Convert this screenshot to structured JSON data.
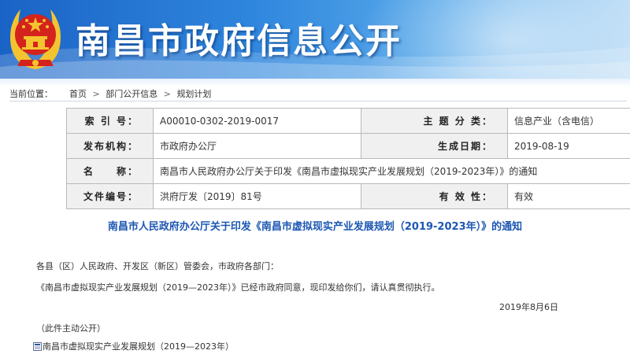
{
  "header": {
    "site_title": "南昌市政府信息公开",
    "colors": {
      "banner_dark": "#1a63c6",
      "banner_light": "#bcdcf6",
      "emblem_red": "#d4231c",
      "emblem_gold": "#f4c430"
    }
  },
  "breadcrumb": {
    "prefix": "当前位置：",
    "items": [
      "首页",
      "部门公开信息",
      "规划计划"
    ],
    "separator": ">"
  },
  "info": {
    "index_label": "索 引 号：",
    "index_value": "A00010-0302-2019-0017",
    "topic_label": "主 题 分 类：",
    "topic_value": "信息产业（含电信）",
    "org_label": "发布机构：",
    "org_value": "市政府办公厅",
    "date_label": "生成日期：",
    "date_value": "2019-08-19",
    "name_label": "名　　称：",
    "name_value": "南昌市人民政府办公厅关于印发《南昌市虚拟现实产业发展规划（2019-2023年）》的通知",
    "docno_label": "文件编号：",
    "docno_value": "洪府厅发〔2019〕81号",
    "validity_label": "有 效 性：",
    "validity_value": "有效"
  },
  "article": {
    "title": "南昌市人民政府办公厅关于印发《南昌市虚拟现实产业发展规划（2019-2023年）》的通知",
    "salutation": "各县（区）人民政府、开发区（新区）管委会，市政府各部门：",
    "body": "《南昌市虚拟现实产业发展规划（2019—2023年）》已经市政府同意，现印发给你们，请认真贯彻执行。",
    "date": "2019年8月6日",
    "note": "（此件主动公开）",
    "attachment": "南昌市虚拟现实产业发展规划（2019—2023年）"
  }
}
